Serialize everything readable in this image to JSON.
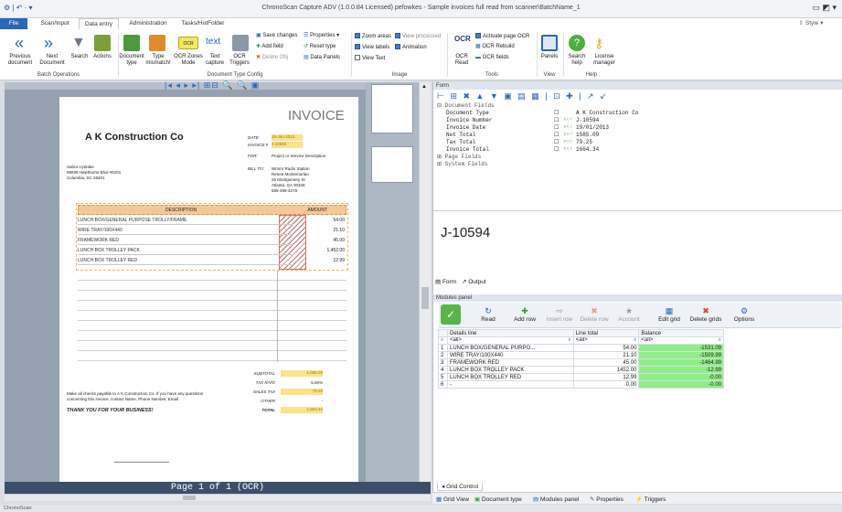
{
  "window": {
    "title": "ChronoScan Capture ADV (1.0.0.84 Licensed) pefowkes - Sample invoices full read from scanner\\BatchName_1",
    "style_label": "Style"
  },
  "tabs": [
    "File",
    "Scan/Input",
    "Data entry",
    "Administration",
    "Tasks/HotFolder"
  ],
  "ribbon": {
    "batch_ops": {
      "label": "Batch Operations",
      "buttons": [
        "Previous document",
        "Next Document",
        "Search",
        "Actions"
      ]
    },
    "doc_type_config": {
      "label": "Document Type Config",
      "buttons": [
        "Document type",
        "Type mismatch!",
        "OCR Zones Mode",
        "Text capture",
        "OCR Triggers"
      ],
      "small": [
        "Save changes",
        "Properties",
        "Add field",
        "Reset type",
        "Delete Obj",
        "Data Panels"
      ]
    },
    "image": {
      "label": "Image",
      "checks": [
        "Zoom areas",
        "View processed",
        "View labels",
        "Animation",
        "View Text"
      ]
    },
    "tools": {
      "label": "Tools",
      "big": "OCR Read",
      "small": [
        "Activate page OCR",
        "OCR Rebuild",
        "OCR fields"
      ]
    },
    "view": {
      "label": "View",
      "buttons": [
        "Panels"
      ]
    },
    "help": {
      "label": "Help",
      "buttons": [
        "Search help",
        "License manager"
      ]
    }
  },
  "invoice": {
    "heading": "INVOICE",
    "company": "A K Construction Co",
    "date_label": "DATE:",
    "date_value": "19-Jan-2013",
    "invoice_label": "INVOICE #",
    "invoice_value": "J-10594",
    "for_label": "FOR:",
    "for_value": "Project or Service Description",
    "billto_label": "BILL TO:",
    "from_lines": [
      "Sabra Uyetake",
      "98839 Hawthorne Blvd #6101",
      "Columbia, SC 29201"
    ],
    "billto_lines": [
      "Wmmr Radio Station",
      "Renea Montemurlao",
      "26 Montgomery St",
      "Atlanta, GA 30328",
      "585-498-4278"
    ],
    "col_description": "DESCRIPTION",
    "col_amount": "AMOUNT",
    "items": [
      {
        "desc": "LUNCH BOX/GENERAL PURPOSE TROLLY/FRAME",
        "amount": "54.00"
      },
      {
        "desc": "WIRE TRAY/100X440",
        "amount": "21.10"
      },
      {
        "desc": "FRAMEWORK RED",
        "amount": "45.00"
      },
      {
        "desc": "LUNCH BOX TROLLEY PACK",
        "amount": "1,452.00"
      },
      {
        "desc": "LUNCH BOX TROLLEY RED",
        "amount": "12.99"
      }
    ],
    "subtotal_label": "SUBTOTAL",
    "subtotal_value": "1,585.09",
    "taxrate_label": "TAX RATE",
    "taxrate_value": "5.00%",
    "salestax_label": "SALES TAX",
    "salestax_value": "79.25",
    "other_label": "OTHER",
    "other_value": "-",
    "total_label": "TOTAL",
    "total_value": "1,664.34",
    "note": "Make all checks payable to A K Construction Co. If you have any questions concerning this invoice, contact Name, Phone Number, Email",
    "thanks": "THANK YOU FOR YOUR BUSINESS!"
  },
  "pager": "Page 1 of 1 (OCR)",
  "form": {
    "title": "Form",
    "groups": [
      "Document Fields",
      "Page Fields",
      "System Fields"
    ],
    "fields": [
      {
        "name": "Document Type",
        "value": "A K Construction Co"
      },
      {
        "name": "Invoice Number",
        "value": "J-10594"
      },
      {
        "name": "Invoice Date",
        "value": "19/01/2013"
      },
      {
        "name": "Net Total",
        "value": "1585.09"
      },
      {
        "name": "Tax Total",
        "value": "79.25"
      },
      {
        "name": "Invoice Total",
        "value": "1664.34"
      }
    ],
    "preview": "J-10594",
    "tabs": [
      "Form",
      "Output"
    ]
  },
  "modules": {
    "title": "Modules panel",
    "buttons": [
      "Read",
      "Add row",
      "Insert row",
      "Delete row",
      "Account",
      "Edit grid",
      "Delete grids",
      "Options"
    ],
    "columns": [
      "Details line",
      "Line total",
      "Balance"
    ],
    "filter": "<all>",
    "rows": [
      {
        "n": "1",
        "detail": "LUNCH BOX/GENERAL PURPO...",
        "total": "54.00",
        "balance": "-1531.09"
      },
      {
        "n": "2",
        "detail": "WIRE TRAY/100X440",
        "total": "21.10",
        "balance": "-1509.99"
      },
      {
        "n": "3",
        "detail": "FRAMEWORK RED",
        "total": "45.00",
        "balance": "-1464.99"
      },
      {
        "n": "4",
        "detail": "LUNCH BOX TROLLEY PACK",
        "total": "1452.00",
        "balance": "-12.99"
      },
      {
        "n": "5",
        "detail": "LUNCH BOX TROLLEY RED",
        "total": "12.99",
        "balance": "-0.00"
      },
      {
        "n": "6",
        "detail": "-",
        "total": "0.00",
        "balance": "-0.00"
      }
    ],
    "grid_tab": "Grid Control"
  },
  "bottom_tabs": [
    "Grid View",
    "Document type",
    "Modules panel",
    "Properties",
    "Triggers"
  ],
  "status": "ChronoScan"
}
